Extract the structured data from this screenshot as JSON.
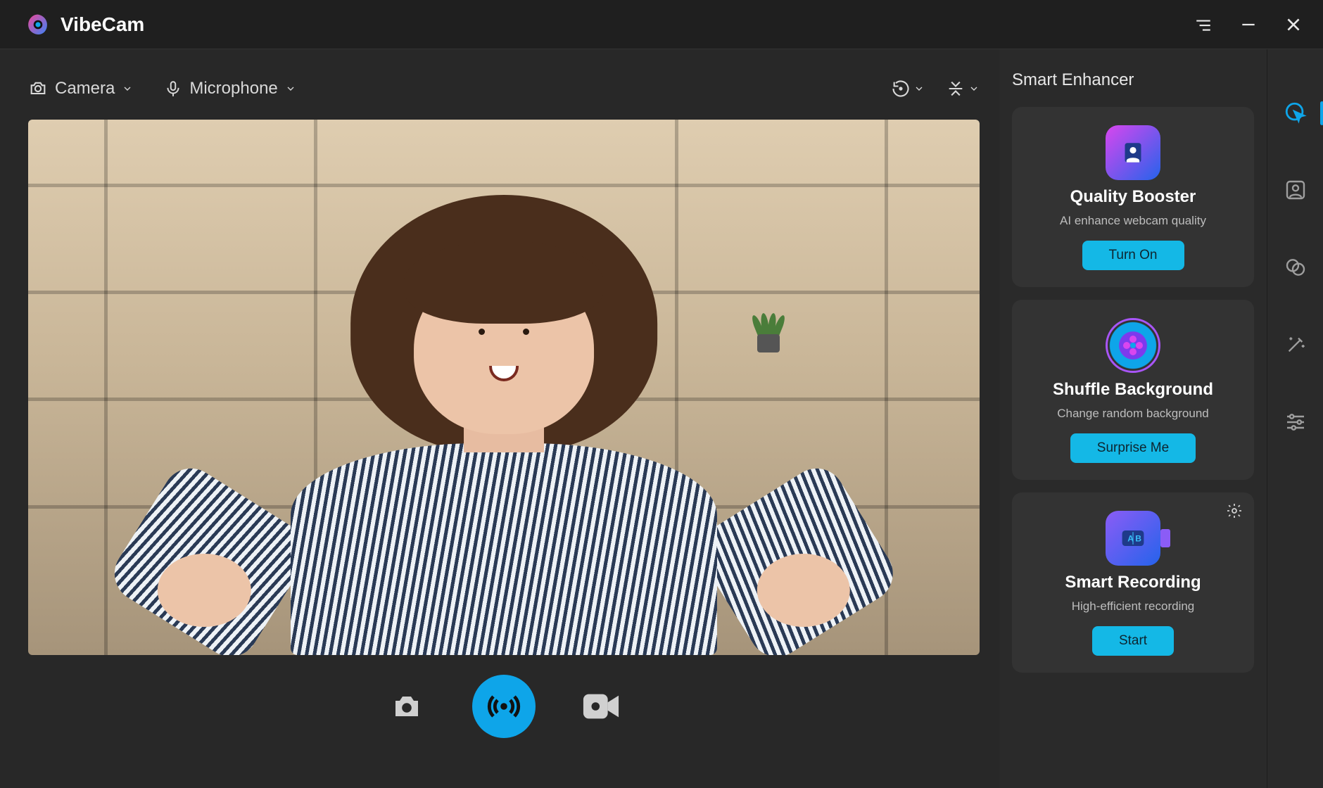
{
  "app": {
    "title": "VibeCam"
  },
  "toolbar": {
    "camera_label": "Camera",
    "microphone_label": "Microphone"
  },
  "side_panel": {
    "title": "Smart Enhancer",
    "cards": [
      {
        "title": "Quality Booster",
        "description": "AI enhance webcam quality",
        "button": "Turn On"
      },
      {
        "title": "Shuffle Background",
        "description": "Change random background",
        "button": "Surprise Me"
      },
      {
        "title": "Smart Recording",
        "description": "High-efficient recording",
        "button": "Start"
      }
    ]
  },
  "rail": {
    "items": [
      "smart-enhancer",
      "portrait",
      "replace-background",
      "magic-wand",
      "sliders"
    ],
    "active_index": 0
  },
  "colors": {
    "accent": "#0ea5e9",
    "button": "#14b8e6"
  }
}
